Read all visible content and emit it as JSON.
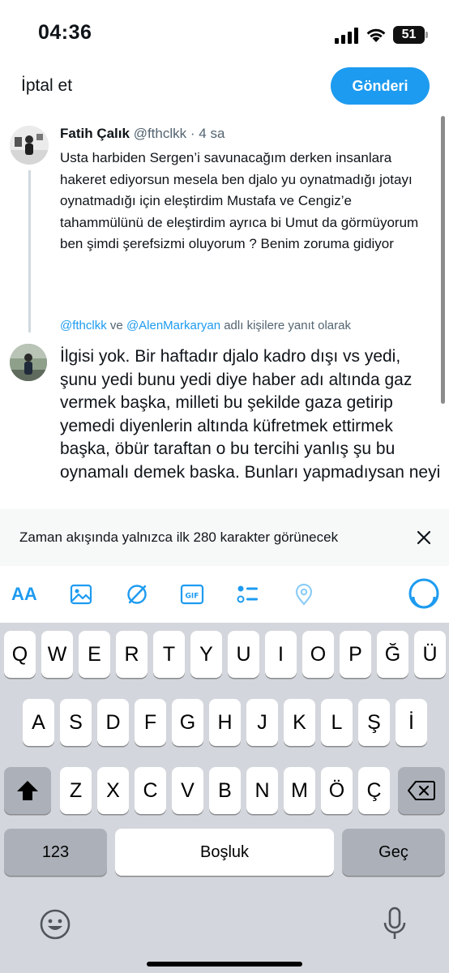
{
  "status": {
    "time": "04:36",
    "battery": "51"
  },
  "header": {
    "cancel_label": "İptal et",
    "send_label": "Gönderi"
  },
  "original_tweet": {
    "name": "Fatih Çalık",
    "handle": "@fthclkk",
    "separator": "·",
    "time": "4 sa",
    "text": "Usta harbiden Sergen’i savunacağım derken insanlara hakeret ediyorsun mesela ben djalo yu oynatmadığı jotayı oynatmadığı için eleştirdim Mustafa ve Cengiz’e tahammülünü de eleştirdim ayrıca bi Umut da görmüyorum ben şimdi şerefsizmi oluyorum ? Benim zoruma gidiyor"
  },
  "reply_to": {
    "mention_1": "@fthclkk",
    "connector": " ve ",
    "mention_2": "@AlenMarkaryan",
    "suffix": " adlı kişilere yanıt olarak"
  },
  "compose": {
    "text": "İlgisi yok. Bir haftadır djalo kadro dışı vs yedi, şunu yedi bunu yedi diye haber adı altında gaz vermek başka, milleti bu şekilde gaza getirip yemedi diyenlerin altında küfretmek ettirmek başka, öbür taraftan o bu tercihi yanlış şu bu oynamalı demek baska. Bunları yapmadıysan neyi"
  },
  "warning": {
    "text": "Zaman akışında yalnızca ilk 280 karakter görünecek"
  },
  "toolbar": {
    "text_size_label": "AA",
    "gif_label": "GIF",
    "accent_color": "#1d9bf0",
    "icons": [
      "text-size-icon",
      "image-icon",
      "no-sign-icon",
      "gif-icon",
      "poll-icon",
      "location-icon",
      "character-counter-icon"
    ]
  },
  "keyboard": {
    "row1": [
      "Q",
      "W",
      "E",
      "R",
      "T",
      "Y",
      "U",
      "I",
      "O",
      "P",
      "Ğ",
      "Ü"
    ],
    "row2": [
      "A",
      "S",
      "D",
      "F",
      "G",
      "H",
      "J",
      "K",
      "L",
      "Ş",
      "İ"
    ],
    "row3": [
      "Z",
      "X",
      "C",
      "V",
      "B",
      "N",
      "M",
      "Ö",
      "Ç"
    ],
    "numbers_label": "123",
    "space_label": "Boşluk",
    "return_label": "Geç"
  }
}
